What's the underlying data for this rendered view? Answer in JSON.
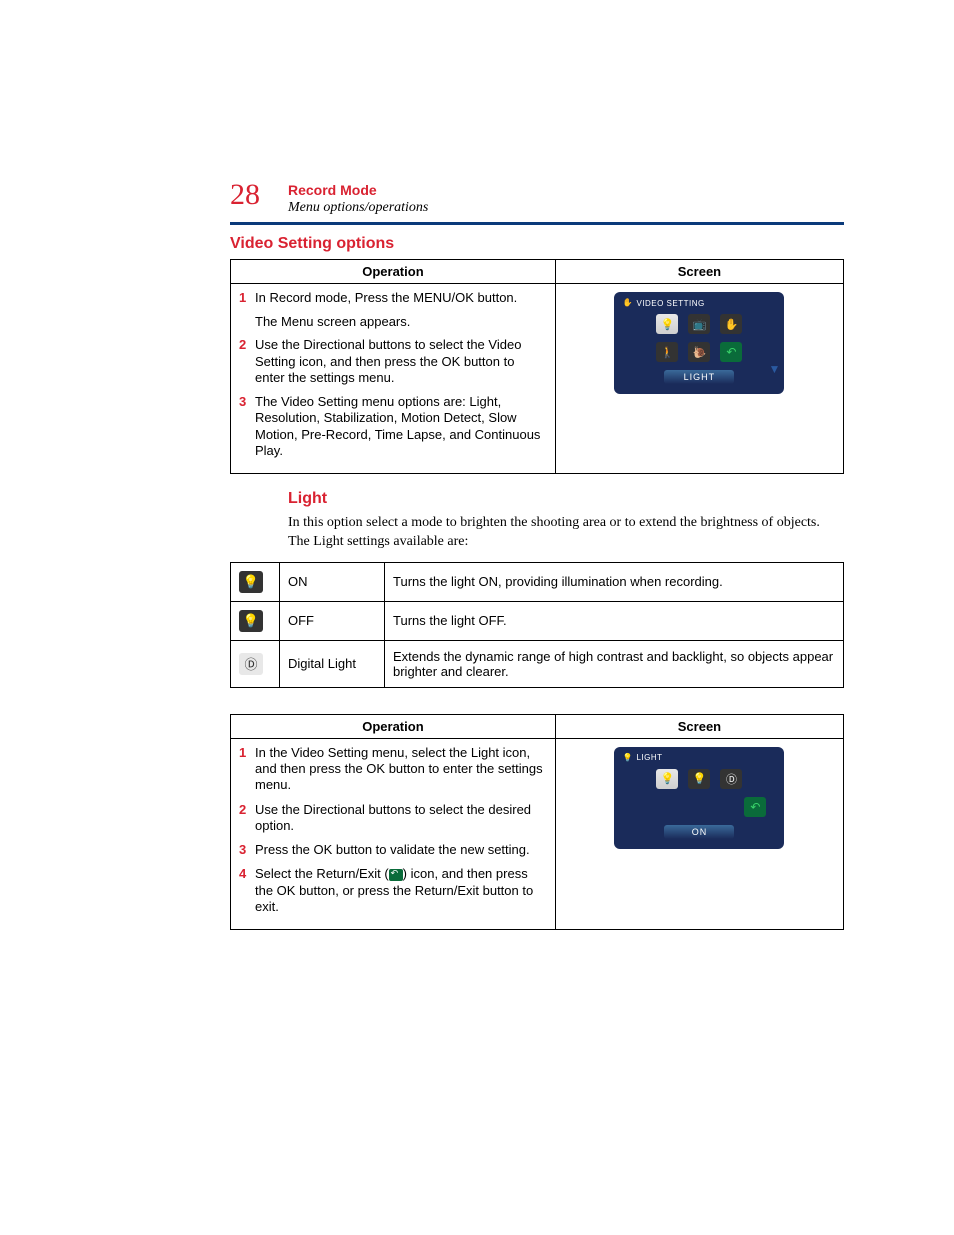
{
  "page_number": "28",
  "chapter_title": "Record Mode",
  "chapter_subtitle": "Menu options/operations",
  "section_heading": "Video Setting options",
  "table1": {
    "col_operation": "Operation",
    "col_screen": "Screen",
    "steps": [
      {
        "num": "1",
        "text": "In Record mode, Press the MENU/OK button."
      },
      {
        "sub": "The Menu screen appears."
      },
      {
        "num": "2",
        "text": "Use the Directional buttons to select the Video Setting icon, and then press the OK button to enter the settings menu."
      },
      {
        "num": "3",
        "text": "The Video Setting menu options are: Light, Resolution, Stabilization, Motion Detect, Slow Motion, Pre-Record, Time Lapse, and Continuous Play."
      }
    ],
    "screen": {
      "title": "VIDEO SETTING",
      "status": "LIGHT"
    }
  },
  "subsection_heading": "Light",
  "light_intro": "In this option select a mode to brighten the shooting area or to extend the brightness of objects. The Light settings available are:",
  "options_table": [
    {
      "name": "ON",
      "desc": "Turns the light ON, providing illumination when recording."
    },
    {
      "name": "OFF",
      "desc": "Turns the light OFF."
    },
    {
      "name": "Digital Light",
      "desc": "Extends the dynamic range of high contrast and backlight, so objects appear brighter and clearer."
    }
  ],
  "table2": {
    "col_operation": "Operation",
    "col_screen": "Screen",
    "steps": [
      {
        "num": "1",
        "text": "In the Video Setting menu, select the Light icon, and then press the OK button to enter the settings menu."
      },
      {
        "num": "2",
        "text": "Use the Directional buttons to select the desired option."
      },
      {
        "num": "3",
        "text": "Press the OK button to validate the new setting."
      },
      {
        "num": "4",
        "pre": "Select the Return/Exit (",
        "post": ") icon, and then press the OK button, or press the Return/Exit button to exit."
      }
    ],
    "screen": {
      "title": "LIGHT",
      "status": "ON"
    }
  }
}
